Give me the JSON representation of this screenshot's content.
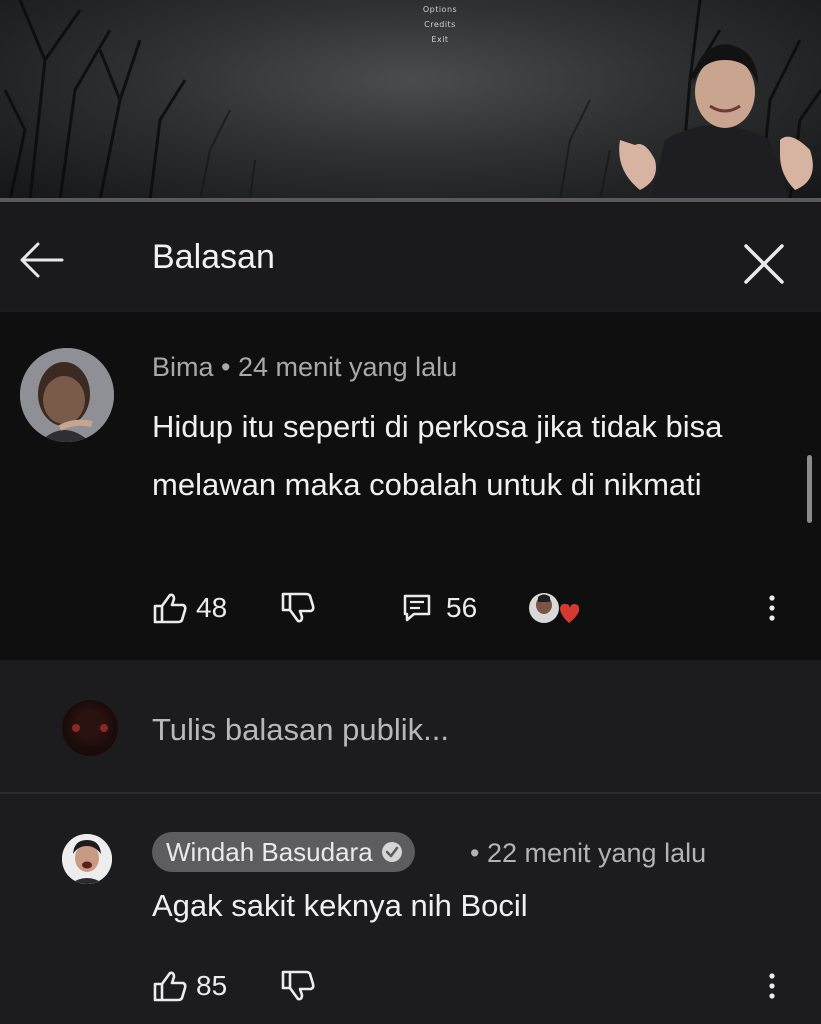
{
  "video": {
    "menu_lines": [
      "Options",
      "Credits",
      "Exit"
    ]
  },
  "header": {
    "title": "Balasan",
    "back_icon": "arrow-left-icon",
    "close_icon": "close-icon"
  },
  "comment": {
    "author": "Bima",
    "separator": " • ",
    "time": "24 menit yang lalu",
    "text": "Hidup itu seperti di perkosa jika tidak bisa melawan maka cobalah untuk di nikmati",
    "likes": "48",
    "replies": "56"
  },
  "reply_input": {
    "placeholder": "Tulis balasan publik..."
  },
  "reply": {
    "author": "Windah Basudara",
    "separator": "• ",
    "time": "22 menit yang lalu",
    "text": "Agak sakit keknya nih Bocil",
    "likes": "85"
  },
  "colors": {
    "background": "#1b1b1d",
    "comment_bg": "#0f0f10",
    "name_chip": "#5d5d5f",
    "text": "#f0f0f0",
    "muted": "#a9a9a9"
  }
}
